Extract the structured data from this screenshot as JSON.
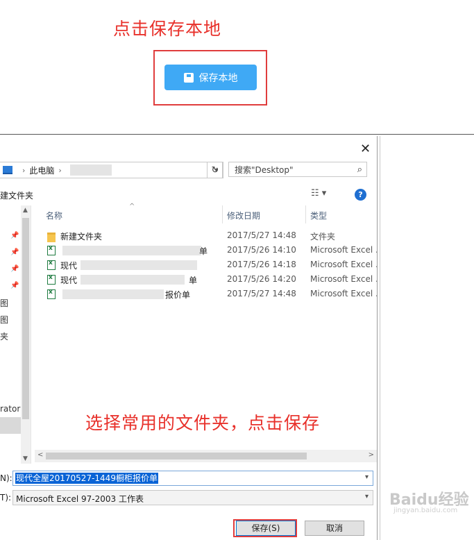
{
  "annotations": {
    "top": "点击保存本地",
    "bottom": "选择常用的文件夹，点击保存"
  },
  "page": {
    "save_local_label": "保存本地"
  },
  "dialog": {
    "breadcrumb": {
      "this_pc": "此电脑"
    },
    "search_placeholder": "搜索\"Desktop\"",
    "new_folder_label": "建文件夹",
    "help_label": "?",
    "nav_items": [
      "图",
      "图",
      "夹",
      "rator"
    ],
    "columns": {
      "name": "名称",
      "modified": "修改日期",
      "type": "类型"
    },
    "files": [
      {
        "name": "新建文件夹",
        "date": "2017/5/27 14:48",
        "type": "文件夹",
        "icon": "folder-icon"
      },
      {
        "name": "",
        "date": "2017/5/26 14:10",
        "type": "Microsoft Excel ...",
        "icon": "excel-icon"
      },
      {
        "name": "现代",
        "date": "2017/5/26 14:18",
        "type": "Microsoft Excel ...",
        "icon": "excel-icon"
      },
      {
        "name": "现代",
        "date": "2017/5/26 14:20",
        "type": "Microsoft Excel ...",
        "icon": "excel-icon"
      },
      {
        "name": "",
        "date": "2017/5/27 14:48",
        "type": "Microsoft Excel ...",
        "icon": "excel-icon"
      }
    ],
    "file_row_suffixes": [
      "单",
      "",
      "单",
      "报价单"
    ],
    "filename_label": "N):",
    "filename_value": "现代全屋20170527-1449橱柜报价单",
    "filetype_label": "T):",
    "filetype_value": "Microsoft Excel 97-2003 工作表",
    "save_button": "保存(S)",
    "cancel_button": "取消"
  },
  "watermark": {
    "main": "Baidu经验",
    "sub": "jingyan.baidu.com"
  },
  "colors": {
    "annotation_red": "#e8302a",
    "button_blue": "#3fa9f5",
    "selection_blue": "#0a64d6",
    "help_blue": "#1f6fd1"
  }
}
